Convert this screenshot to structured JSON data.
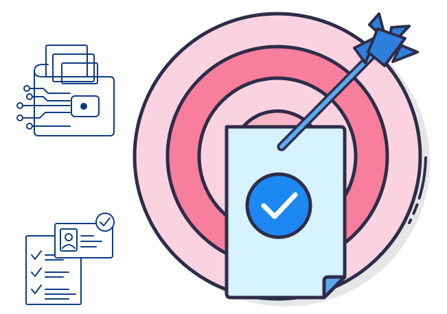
{
  "illustrations": [
    {
      "name": "digital-wallet-icon"
    },
    {
      "name": "verified-id-checklist-icon"
    },
    {
      "name": "target-approved-document-icon"
    }
  ],
  "colors": {
    "line_navy": "#0d3b82",
    "outline_dark": "#2d2d4a",
    "ring_light_pink": "#fbd3e0",
    "ring_mid_pink": "#f77e9c",
    "ring_center_pink": "#f9b6c8",
    "paper_light_blue": "#d6f2ff",
    "check_circle_blue": "#1e88f2",
    "arrow_blue": "#5aa9f0",
    "fletching_blue": "#2f80dc",
    "shadow_gray": "#e6e6e9"
  }
}
